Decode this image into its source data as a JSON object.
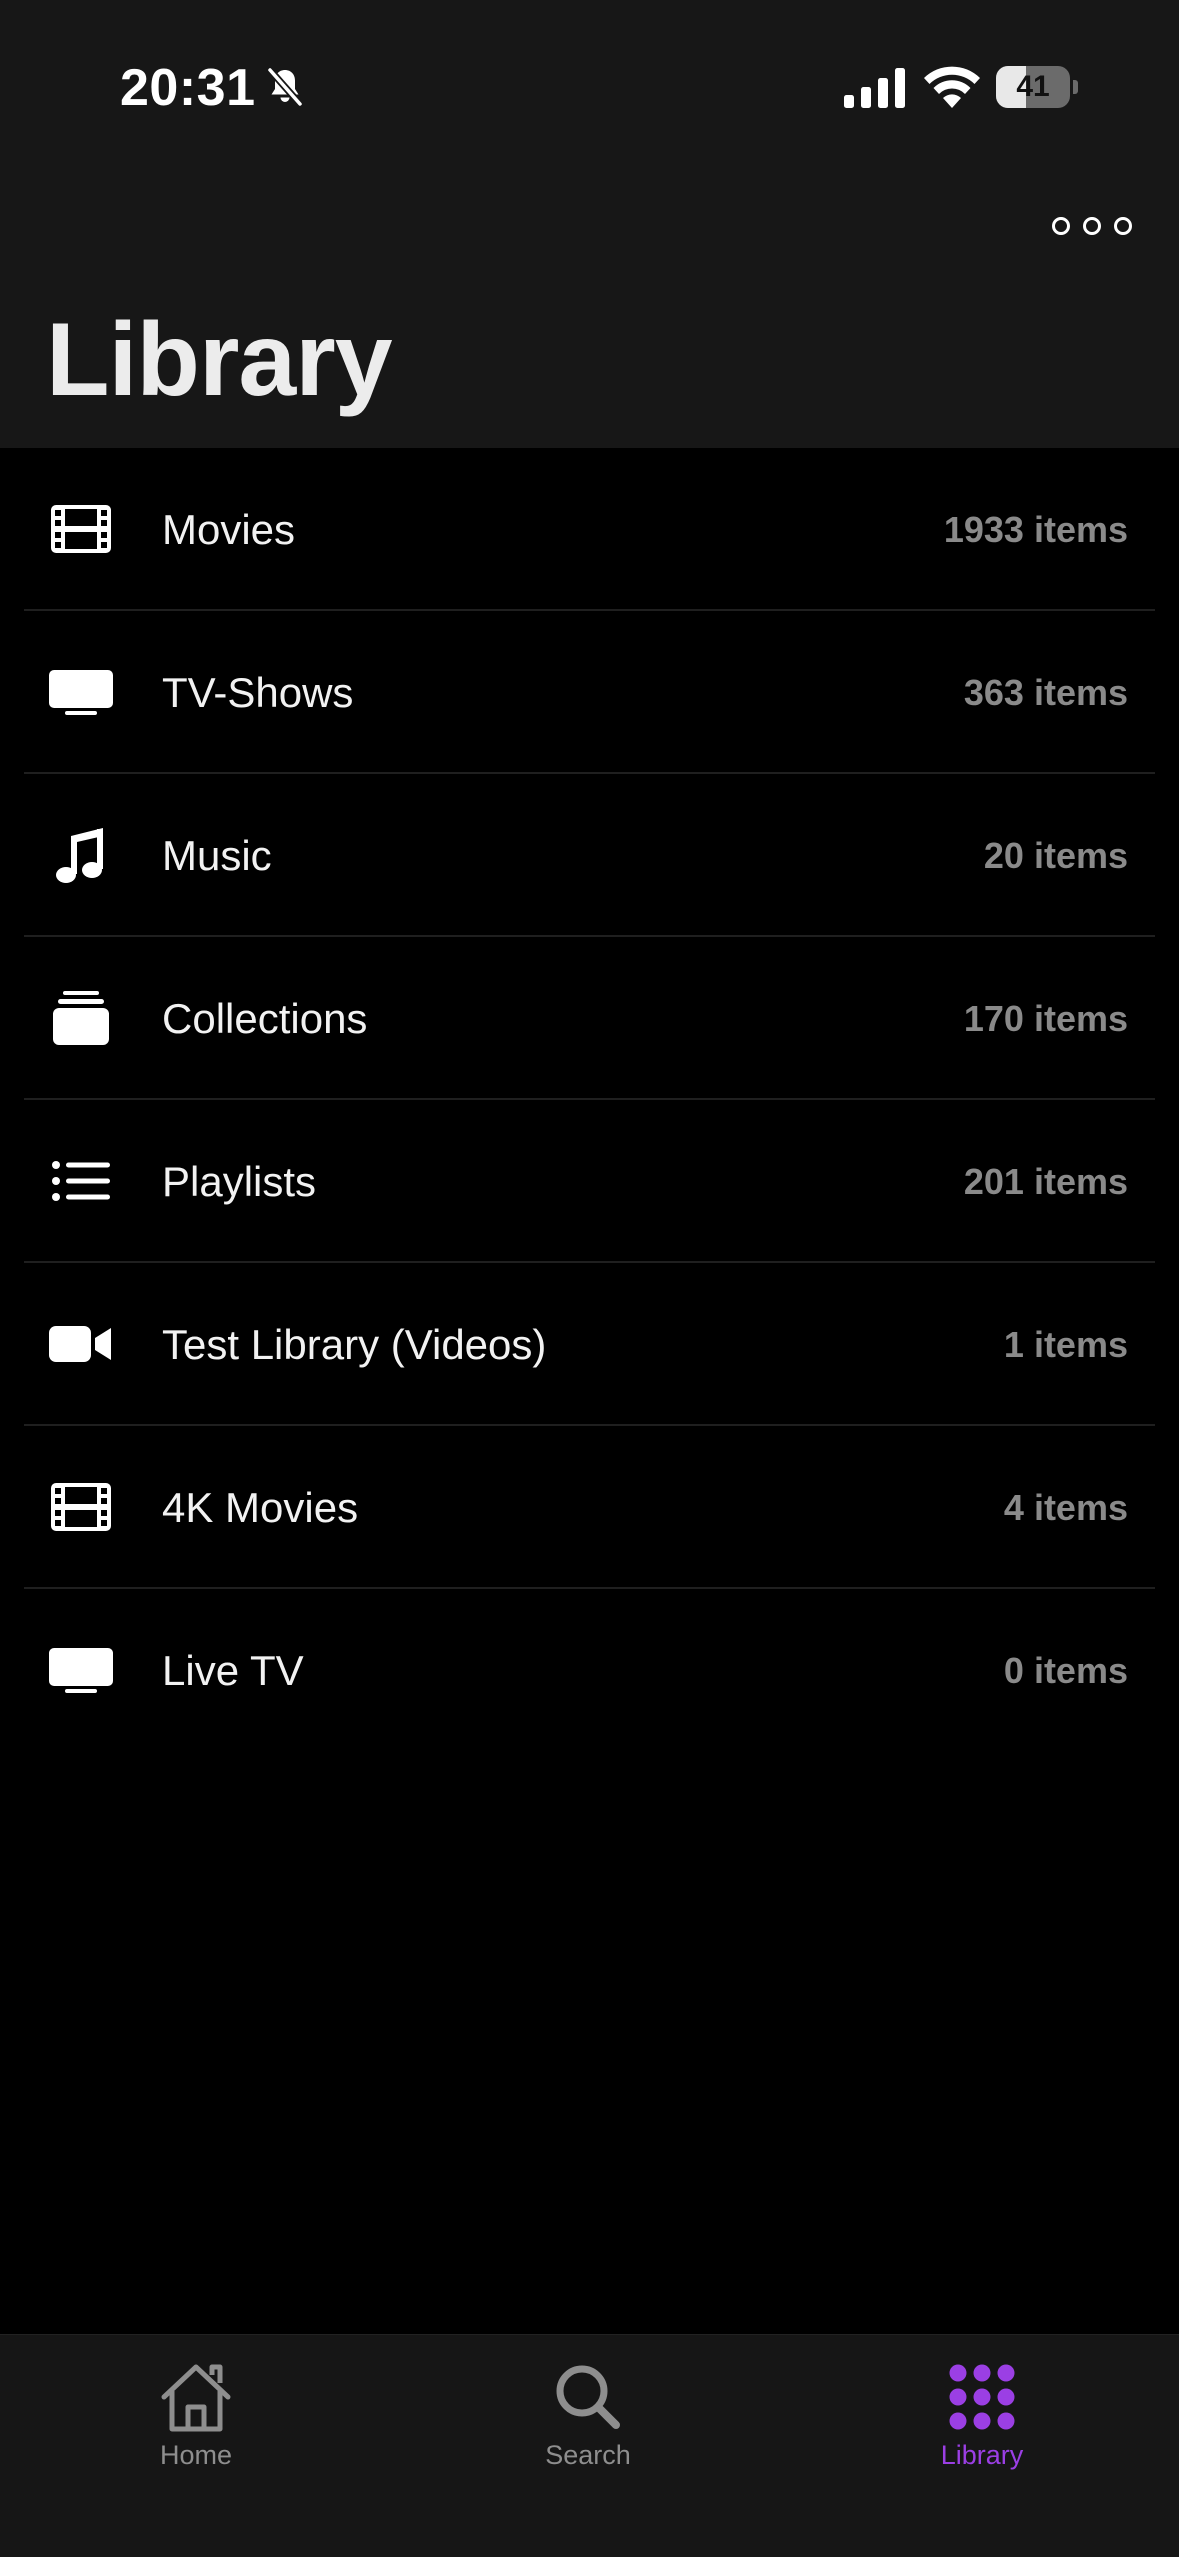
{
  "status_bar": {
    "time": "20:31",
    "battery_percent": "41",
    "battery_level": 0.41
  },
  "nav": {
    "more_icon": "ellipsis-circle-icon"
  },
  "page": {
    "title": "Library"
  },
  "libraries": [
    {
      "label": "Movies",
      "count": "1933 items",
      "icon": "film-icon"
    },
    {
      "label": "TV-Shows",
      "count": "363 items",
      "icon": "tv-icon"
    },
    {
      "label": "Music",
      "count": "20 items",
      "icon": "music-note-icon"
    },
    {
      "label": "Collections",
      "count": "170 items",
      "icon": "stack-icon"
    },
    {
      "label": "Playlists",
      "count": "201 items",
      "icon": "list-icon"
    },
    {
      "label": "Test Library (Videos)",
      "count": "1 items",
      "icon": "video-camera-icon"
    },
    {
      "label": "4K Movies",
      "count": "4 items",
      "icon": "film-icon"
    },
    {
      "label": "Live TV",
      "count": "0 items",
      "icon": "tv-icon"
    }
  ],
  "tab_bar": {
    "home_label": "Home",
    "search_label": "Search",
    "library_label": "Library",
    "active_tab": "Library"
  },
  "colors": {
    "accent": "#9b3fe4",
    "background": "#000000",
    "header_background": "#171717",
    "secondary_text": "#8a8a8a"
  }
}
